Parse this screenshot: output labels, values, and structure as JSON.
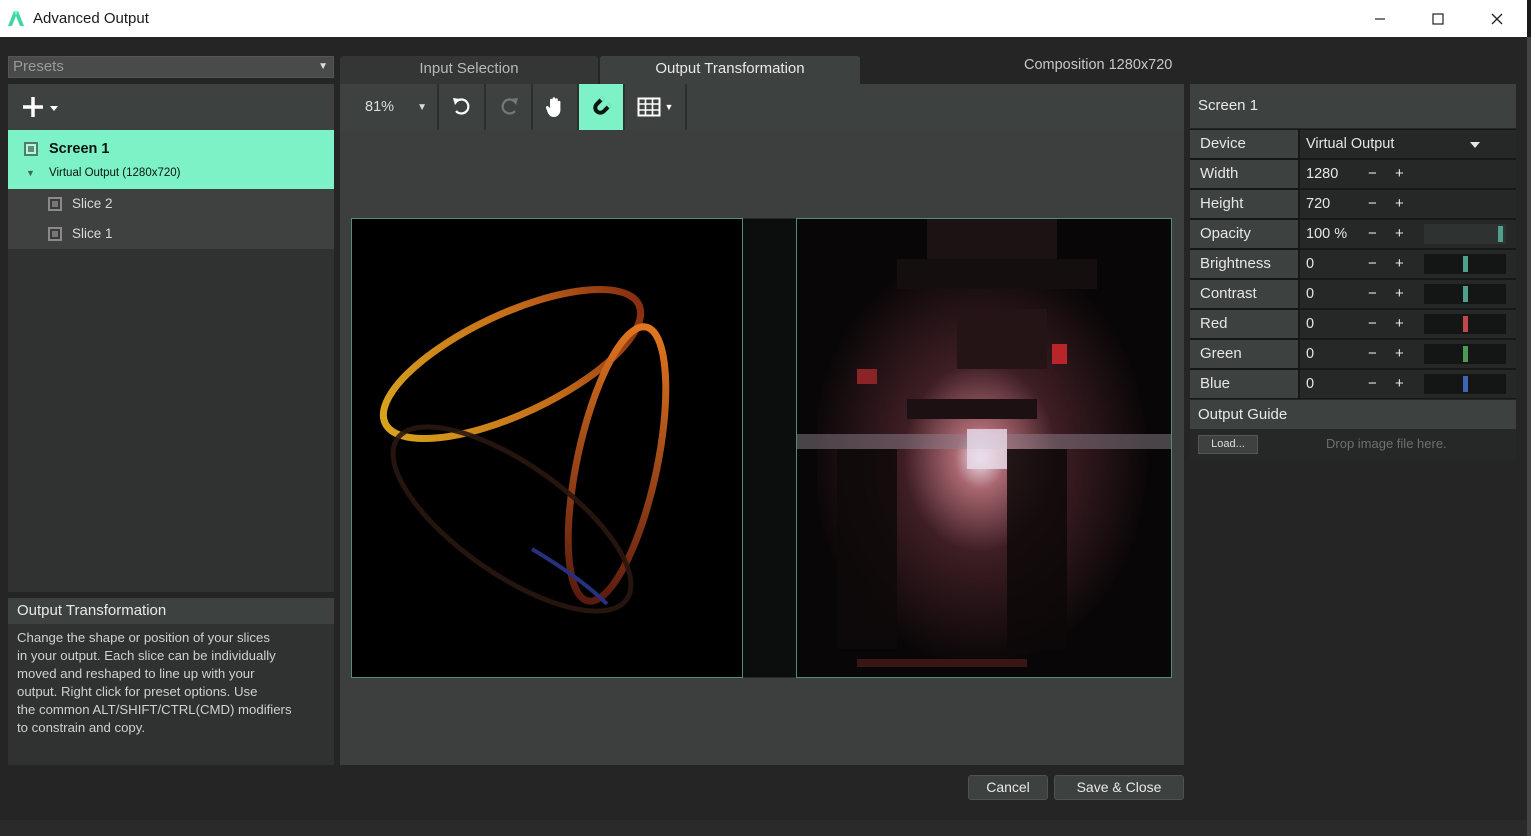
{
  "window": {
    "title": "Advanced Output"
  },
  "presets": {
    "label": "Presets"
  },
  "tree": {
    "screen": {
      "name": "Screen 1",
      "device": "Virtual Output (1280x720)"
    },
    "slices": [
      "Slice 2",
      "Slice 1"
    ]
  },
  "info": {
    "title": "Output Transformation",
    "lines": [
      "Change the shape or position of your slices",
      "in your output. Each slice can be individually",
      "moved and reshaped to line up with your",
      "output. Right click for preset options. Use",
      "the common ALT/SHIFT/CTRL(CMD) modifiers",
      "to constrain and copy."
    ]
  },
  "tabs": {
    "input": "Input Selection",
    "output": "Output Transformation"
  },
  "composition": "Composition 1280x720",
  "toolbar": {
    "zoom": "81%"
  },
  "screen_panel": {
    "title": "Screen 1",
    "device_label": "Device",
    "device_value": "Virtual Output",
    "width_label": "Width",
    "width_value": "1280",
    "height_label": "Height",
    "height_value": "720",
    "opacity_label": "Opacity",
    "opacity_value": "100 %",
    "brightness_label": "Brightness",
    "brightness_value": "0",
    "contrast_label": "Contrast",
    "contrast_value": "0",
    "red_label": "Red",
    "red_value": "0",
    "green_label": "Green",
    "green_value": "0",
    "blue_label": "Blue",
    "blue_value": "0",
    "minus": "−",
    "plus": "+"
  },
  "slider_levels": {
    "opacity": 1.0,
    "brightness": 0.5,
    "contrast": 0.5,
    "red": 0.5,
    "green": 0.5,
    "blue": 0.5
  },
  "slider_colors": {
    "opacity": "#4fa08a",
    "brightness": "#4fa08a",
    "contrast": "#4fa08a",
    "red": "#c0474a",
    "green": "#4c9a55",
    "blue": "#3f65b0"
  },
  "output_guide": {
    "title": "Output Guide",
    "load_label": "Load...",
    "drop_text": "Drop image file here."
  },
  "buttons": {
    "cancel": "Cancel",
    "save": "Save & Close"
  },
  "accent": "#7cf2c6"
}
